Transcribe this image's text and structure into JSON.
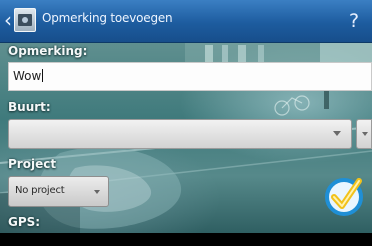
{
  "actionbar": {
    "title": "Opmerking toevoegen",
    "up_icon": "chevron-left-icon",
    "app_icon": "camera-icon",
    "help_label": "?"
  },
  "form": {
    "opmerking_label": "Opmerking:",
    "opmerking_value": "Wow",
    "buurt_label": "Buurt:",
    "buurt_value": "",
    "project_label": "Project",
    "project_value": "No project",
    "gps_label": "GPS:"
  },
  "confirm_icon": "checkmark-icon",
  "colors": {
    "actionbar": "#1d5c9f",
    "background_tint": "#3f7a7c",
    "checkmark_blue": "#1f8fd6",
    "checkmark_yellow": "#f2c21b"
  }
}
